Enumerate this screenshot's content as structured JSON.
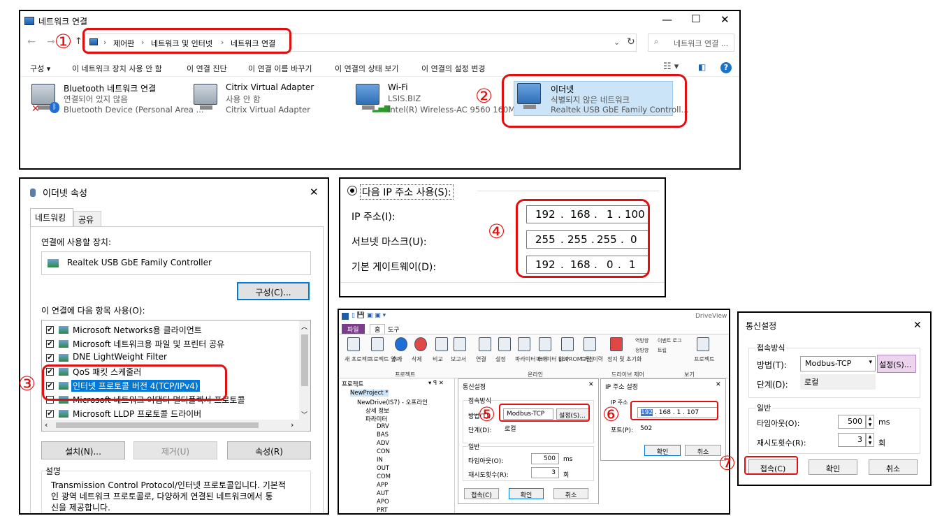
{
  "annotations": [
    "①",
    "②",
    "③",
    "④",
    "⑤",
    "⑥",
    "⑦"
  ],
  "netconn": {
    "title": "네트워크 연결",
    "controls": {
      "min": "—",
      "max": "☐",
      "close": "✕"
    },
    "breadcrumb": [
      "제어판",
      "네트워크 및 인터넷",
      "네트워크 연결"
    ],
    "search_placeholder": "네트워크 연결 ...",
    "toolbar": [
      "구성 ▾",
      "이 네트워크 장치 사용 안 함",
      "이 연결 진단",
      "이 연결 이름 바꾸기",
      "이 연결의 상태 보기",
      "이 연결의 설정 변경"
    ],
    "adapters": [
      {
        "name": "Bluetooth 네트워크 연결",
        "status": "연결되어 있지 않음",
        "device": "Bluetooth Device (Personal Area ..."
      },
      {
        "name": "Citrix Virtual Adapter",
        "status": "사용 안 함",
        "device": "Citrix Virtual Adapter"
      },
      {
        "name": "Wi-Fi",
        "status": "LSIS.BIZ",
        "device": "Intel(R) Wireless-AC 9560 160MHz"
      },
      {
        "name": "이더넷",
        "status": "식별되지 않은 네트워크",
        "device": "Realtek USB GbE Family Controll..."
      }
    ]
  },
  "ethprops": {
    "title": "이더넷 속성",
    "tabs": [
      "네트워킹",
      "공유"
    ],
    "connect_using_label": "연결에 사용할 장치:",
    "device": "Realtek USB GbE Family Controller",
    "configure_btn": "구성(C)...",
    "items_label": "이 연결에 다음 항목 사용(O):",
    "items": [
      {
        "label": "Microsoft Networks용 클라이언트",
        "checked": true
      },
      {
        "label": "Microsoft 네트워크용 파일 및 프린터 공유",
        "checked": true
      },
      {
        "label": "DNE LightWeight Filter",
        "checked": true
      },
      {
        "label": "QoS 패킷 스케줄러",
        "checked": true
      },
      {
        "label": "인터넷 프로토콜 버전 4(TCP/IPv4)",
        "checked": true
      },
      {
        "label": "Microsoft 네트워크 어댑터 멀티플렉서 프로토콜",
        "checked": false
      },
      {
        "label": "Microsoft LLDP 프로토콜 드라이버",
        "checked": true
      },
      {
        "label": "인터넷 프로토콜 버전 6(TCP/IPv6)",
        "checked": true
      }
    ],
    "install_btn": "설치(N)...",
    "remove_btn": "제거(U)",
    "props_btn": "속성(R)",
    "desc_label": "설명",
    "desc_text_1": "Transmission Control Protocol/인터넷 프로토콜입니다. 기본적",
    "desc_text_2": "인 광역 네트워크 프로토콜로, 다양하게 연결된 네트워크에서 통",
    "desc_text_3": "신을 제공합니다."
  },
  "ipset": {
    "radio": "다음 IP 주소 사용(S):",
    "ip_label": "IP 주소(I):",
    "ip": [
      "192",
      "168",
      "1",
      "100"
    ],
    "mask_label": "서브넷 마스크(U):",
    "mask": [
      "255",
      "255",
      "255",
      "0"
    ],
    "gw_label": "기본 게이트웨이(D):",
    "gw": [
      "192",
      "168",
      "0",
      "1"
    ]
  },
  "driveview": {
    "title": "DriveView 9",
    "tabs": [
      "파일",
      "홈",
      "도구"
    ],
    "toolbar": [
      "새 프로젝트",
      "프로젝트 열기",
      "추가",
      "삭제",
      "비교",
      "보고서",
      "연결",
      "설정",
      "파라미터 쓰기",
      "파라미터 읽기",
      "EEPROM 저장",
      "트립 이력",
      "정지 및 초기화",
      "역방향",
      "정방향",
      "이벤트 로그",
      "트립",
      "프로젝트"
    ],
    "groups": [
      "프로젝트",
      "온라인",
      "드라이브 제어",
      "보기"
    ],
    "tree_header": "프로젝트",
    "tree": [
      "NewProject *",
      "NewDrive(IS7) - 오프라인",
      "상세 정보",
      "파라미터",
      "DRV",
      "BAS",
      "ADV",
      "CON",
      "IN",
      "OUT",
      "COM",
      "APP",
      "AUT",
      "APO",
      "PRT"
    ],
    "comm": {
      "title": "통신설정",
      "group1": "접속방식",
      "method_label": "방법(T):",
      "method": "Modbus-TCP",
      "setting_btn": "설정(S)...",
      "step_label": "단계(D):",
      "step": "로컬",
      "group2": "일반",
      "timeout_label": "타임아웃(O):",
      "timeout": "500",
      "timeout_unit": "ms",
      "retry_label": "재시도횟수(R):",
      "retry": "3",
      "retry_unit": "회",
      "connect_btn": "접속(C)",
      "ok_btn": "확인",
      "cancel_btn": "취소"
    },
    "ipdlg": {
      "title": "IP 주소 설정",
      "ip_label": "IP 주소",
      "ip": [
        "192",
        "168",
        "1",
        "107"
      ],
      "port_label": "포트(P):",
      "port": "502",
      "ok_btn": "확인",
      "cancel_btn": "취소"
    }
  },
  "comm_big": {
    "title": "통신설정",
    "group1": "접속방식",
    "method_label": "방법(T):",
    "method": "Modbus-TCP",
    "setting_btn": "설정(S)...",
    "step_label": "단계(D):",
    "step": "로컬",
    "group2": "일반",
    "timeout_label": "타임아웃(O):",
    "timeout": "500",
    "timeout_unit": "ms",
    "retry_label": "재시도횟수(R):",
    "retry": "3",
    "retry_unit": "회",
    "connect_btn": "접속(C)",
    "ok_btn": "확인",
    "cancel_btn": "취소"
  }
}
